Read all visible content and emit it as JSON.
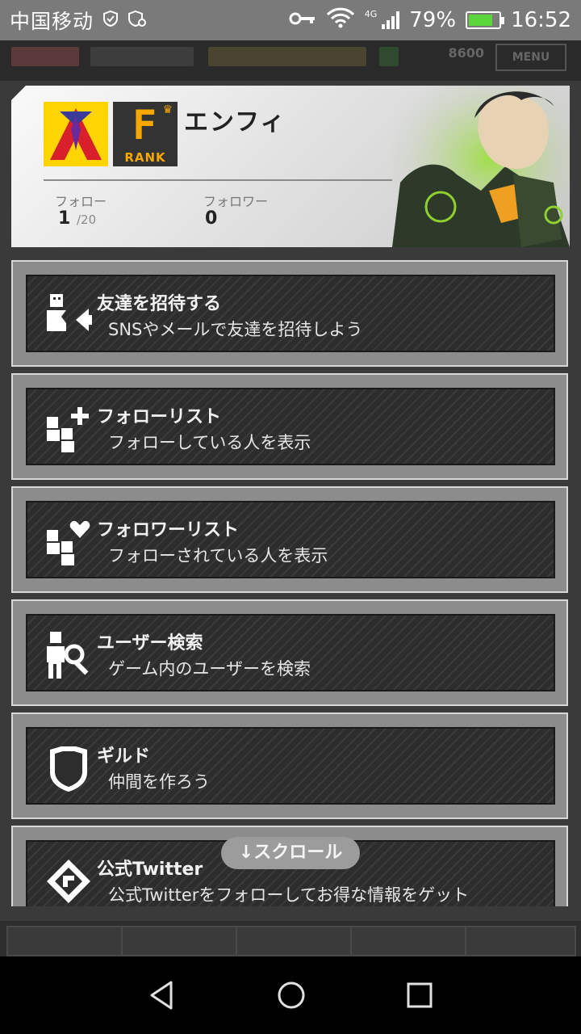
{
  "status_bar": {
    "carrier": "中国移动",
    "network": "4G",
    "battery": "79%",
    "battery_level": 0.79,
    "time": "16:52"
  },
  "game_header": {
    "score": "8600",
    "menu_label": "MENU"
  },
  "profile": {
    "name": "エンフィ",
    "rank_letter": "F",
    "rank_label": "RANK",
    "follow_label": "フォロー",
    "follow_count": "1",
    "follow_max": "/20",
    "follower_label": "フォロワー",
    "follower_count": "0"
  },
  "menu": {
    "items": [
      {
        "title": "友達を招待する",
        "desc": "SNSやメールで友達を招待しよう",
        "icon": "invite-friend-icon"
      },
      {
        "title": "フォローリスト",
        "desc": "フォローしている人を表示",
        "icon": "follow-list-icon"
      },
      {
        "title": "フォロワーリスト",
        "desc": "フォローされている人を表示",
        "icon": "follower-list-icon"
      },
      {
        "title": "ユーザー検索",
        "desc": "ゲーム内のユーザーを検索",
        "icon": "user-search-icon"
      },
      {
        "title": "ギルド",
        "desc": "仲間を作ろう",
        "icon": "guild-shield-icon"
      },
      {
        "title": "公式Twitter",
        "desc": "公式Twitterをフォローしてお得な情報をゲット",
        "icon": "twitter-icon"
      }
    ]
  },
  "scroll_hint": "↓スクロール",
  "colors": {
    "accent": "#f6a800",
    "emblem": "#ffd400",
    "battery": "#5bd63a"
  }
}
